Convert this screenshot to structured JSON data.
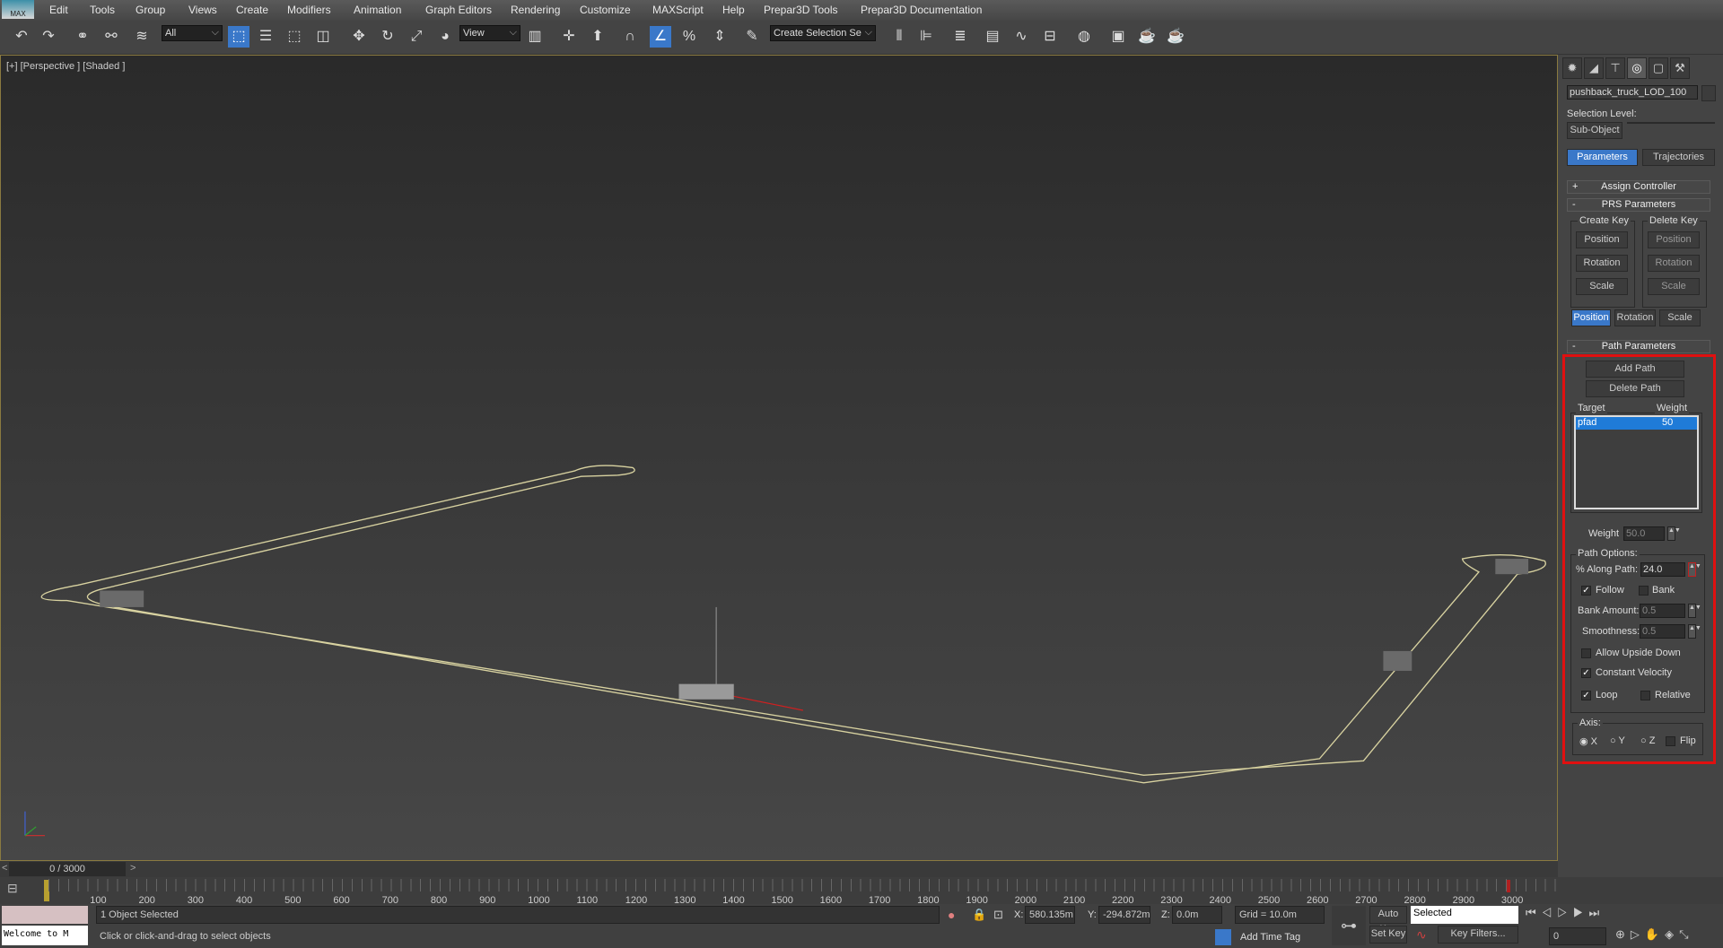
{
  "menu": {
    "logo": "MAX",
    "items": [
      "Edit",
      "Tools",
      "Group",
      "Views",
      "Create",
      "Modifiers",
      "Animation",
      "Graph Editors",
      "Rendering",
      "Customize",
      "MAXScript",
      "Help",
      "Prepar3D Tools",
      "Prepar3D Documentation"
    ]
  },
  "toolbar": {
    "selection_filter": "All",
    "reference_coord": "View",
    "named_selection_placeholder": "Create Selection Se",
    "snap_3d": "3",
    "percent_snap": "%"
  },
  "viewport": {
    "label": "[+] [Perspective ] [Shaded ]",
    "axis_labels": {
      "x": "x",
      "y": "y",
      "z": "z"
    }
  },
  "panel": {
    "tabs": [
      "create-icon",
      "modify-icon",
      "hierarchy-icon",
      "motion-icon",
      "display-icon",
      "utilities-icon"
    ],
    "object_name": "pushback_truck_LOD_100",
    "selection_level_label": "Selection Level:",
    "sub_object": "Sub-Object",
    "parameters": "Parameters",
    "trajectories": "Trajectories",
    "assign_controller": "Assign Controller",
    "prs_parameters": "PRS Parameters",
    "create_key": "Create Key",
    "delete_key": "Delete Key",
    "position": "Position",
    "rotation": "Rotation",
    "scale": "Scale",
    "path_parameters": "Path Parameters",
    "add_path": "Add Path",
    "delete_path": "Delete Path",
    "target_header": "Target",
    "weight_header": "Weight",
    "targets": [
      {
        "name": "pfad",
        "weight": "50"
      }
    ],
    "weight_label": "Weight",
    "weight_value": "50.0",
    "path_options": "Path Options:",
    "along_path_label": "% Along Path:",
    "along_path_value": "24.0",
    "follow": "Follow",
    "follow_checked": true,
    "bank": "Bank",
    "bank_checked": false,
    "bank_amount_label": "Bank Amount:",
    "bank_amount": "0.5",
    "smoothness_label": "Smoothness:",
    "smoothness": "0.5",
    "allow_upside_down": "Allow Upside Down",
    "allow_upside_down_checked": false,
    "constant_velocity": "Constant Velocity",
    "constant_velocity_checked": true,
    "loop": "Loop",
    "loop_checked": true,
    "relative": "Relative",
    "relative_checked": false,
    "axis_label": "Axis:",
    "axis_x": "X",
    "axis_y": "Y",
    "axis_z": "Z",
    "axis_selected": "X",
    "flip": "Flip",
    "flip_checked": false,
    "highlight_color": "#e01010"
  },
  "timeline": {
    "frame": "0 / 3000",
    "prev": "<",
    "next": ">",
    "ticks": [
      "100",
      "200",
      "300",
      "400",
      "500",
      "600",
      "700",
      "800",
      "900",
      "1000",
      "1100",
      "1200",
      "1300",
      "1400",
      "1500",
      "1600",
      "1700",
      "1800",
      "1900",
      "2000",
      "2100",
      "2200",
      "2300",
      "2400",
      "2500",
      "2600",
      "2700",
      "2800",
      "2900",
      "3000"
    ],
    "start": "0"
  },
  "status": {
    "welcome": "Welcome to M",
    "selected": "1 Object Selected",
    "prompt": "Click or click-and-drag to select objects",
    "x_label": "X:",
    "x": "580.135m",
    "y_label": "Y:",
    "y": "-294.872m",
    "z_label": "Z:",
    "z": "0.0m",
    "grid": "Grid = 10.0m",
    "add_time_tag": "Add Time Tag",
    "auto_key": "Auto Key",
    "set_key": "Set Key",
    "key_mode": "Selected",
    "key_filters": "Key Filters...",
    "current_frame": "0"
  }
}
